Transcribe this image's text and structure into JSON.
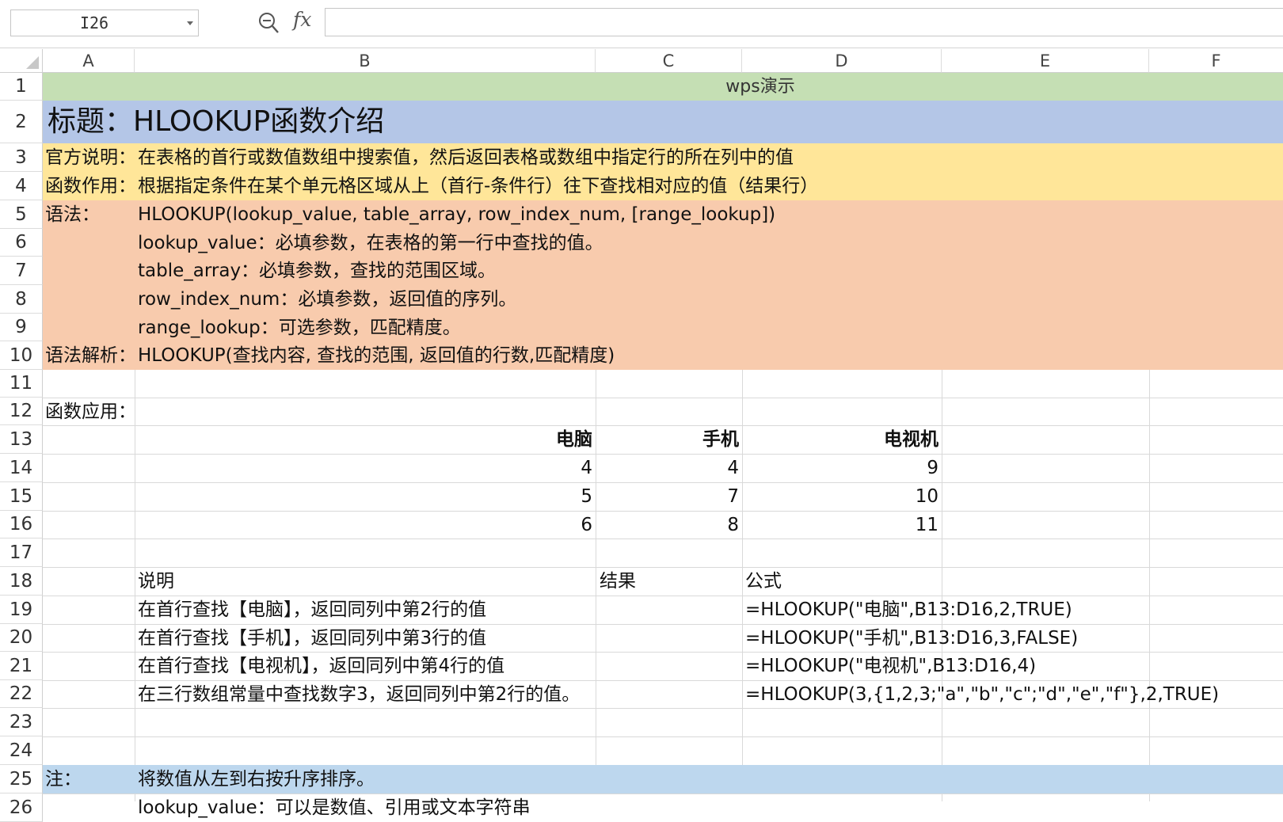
{
  "name_box": "I26",
  "formula_bar": {
    "fx_label": "fx",
    "content": ""
  },
  "columns": [
    "A",
    "B",
    "C",
    "D",
    "E",
    "F"
  ],
  "rows": [
    "1",
    "2",
    "3",
    "4",
    "5",
    "6",
    "7",
    "8",
    "9",
    "10",
    "11",
    "12",
    "13",
    "14",
    "15",
    "16",
    "17",
    "18",
    "19",
    "20",
    "21",
    "22",
    "23",
    "24",
    "25",
    "26"
  ],
  "sheet": {
    "r1": "wps演示",
    "r2": "标题：HLOOKUP函数介绍",
    "r3a": "官方说明：",
    "r3b": "在表格的首行或数值数组中搜索值，然后返回表格或数组中指定行的所在列中的值",
    "r4a": "函数作用：",
    "r4b": "根据指定条件在某个单元格区域从上（首行-条件行）往下查找相对应的值（结果行）",
    "r5a": "语法：",
    "r5b": "HLOOKUP(lookup_value, table_array, row_index_num, [range_lookup])",
    "r6b": "lookup_value：必填参数，在表格的第一行中查找的值。",
    "r7b": "table_array：必填参数，查找的范围区域。",
    "r8b": "row_index_num：必填参数，返回值的序列。",
    "r9b": "range_lookup：可选参数，匹配精度。",
    "r10a": "语法解析：",
    "r10b": "HLOOKUP(查找内容, 查找的范围, 返回值的行数,匹配精度)",
    "r12a": "函数应用：",
    "table_header": [
      "电脑",
      "手机",
      "电视机"
    ],
    "table_rows": [
      [
        "4",
        "4",
        "9"
      ],
      [
        "5",
        "7",
        "10"
      ],
      [
        "6",
        "8",
        "11"
      ]
    ],
    "r18b": "说明",
    "r18c": "结果",
    "r18d": "公式",
    "examples": [
      {
        "desc": "在首行查找【电脑】，返回同列中第2行的值",
        "formula": "=HLOOKUP(\"电脑\",B13:D16,2,TRUE)"
      },
      {
        "desc": "在首行查找【手机】，返回同列中第3行的值",
        "formula": "=HLOOKUP(\"手机\",B13:D16,3,FALSE)"
      },
      {
        "desc": "在首行查找【电视机】，返回同列中第4行的值",
        "formula": "=HLOOKUP(\"电视机\",B13:D16,4)"
      },
      {
        "desc": "在三行数组常量中查找数字3，返回同列中第2行的值。",
        "formula": "=HLOOKUP(3,{1,2,3;\"a\",\"b\",\"c\";\"d\",\"e\",\"f\"},2,TRUE)"
      }
    ],
    "r25a": "注：",
    "r25b": "将数值从左到右按升序排序。",
    "r26b": "lookup_value：可以是数值、引用或文本字符串"
  },
  "colors": {
    "row1": "#c5dfb4",
    "row2": "#b4c6e7",
    "row34": "#ffe699",
    "row510": "#f8cbad",
    "row25": "#bdd7ee"
  }
}
